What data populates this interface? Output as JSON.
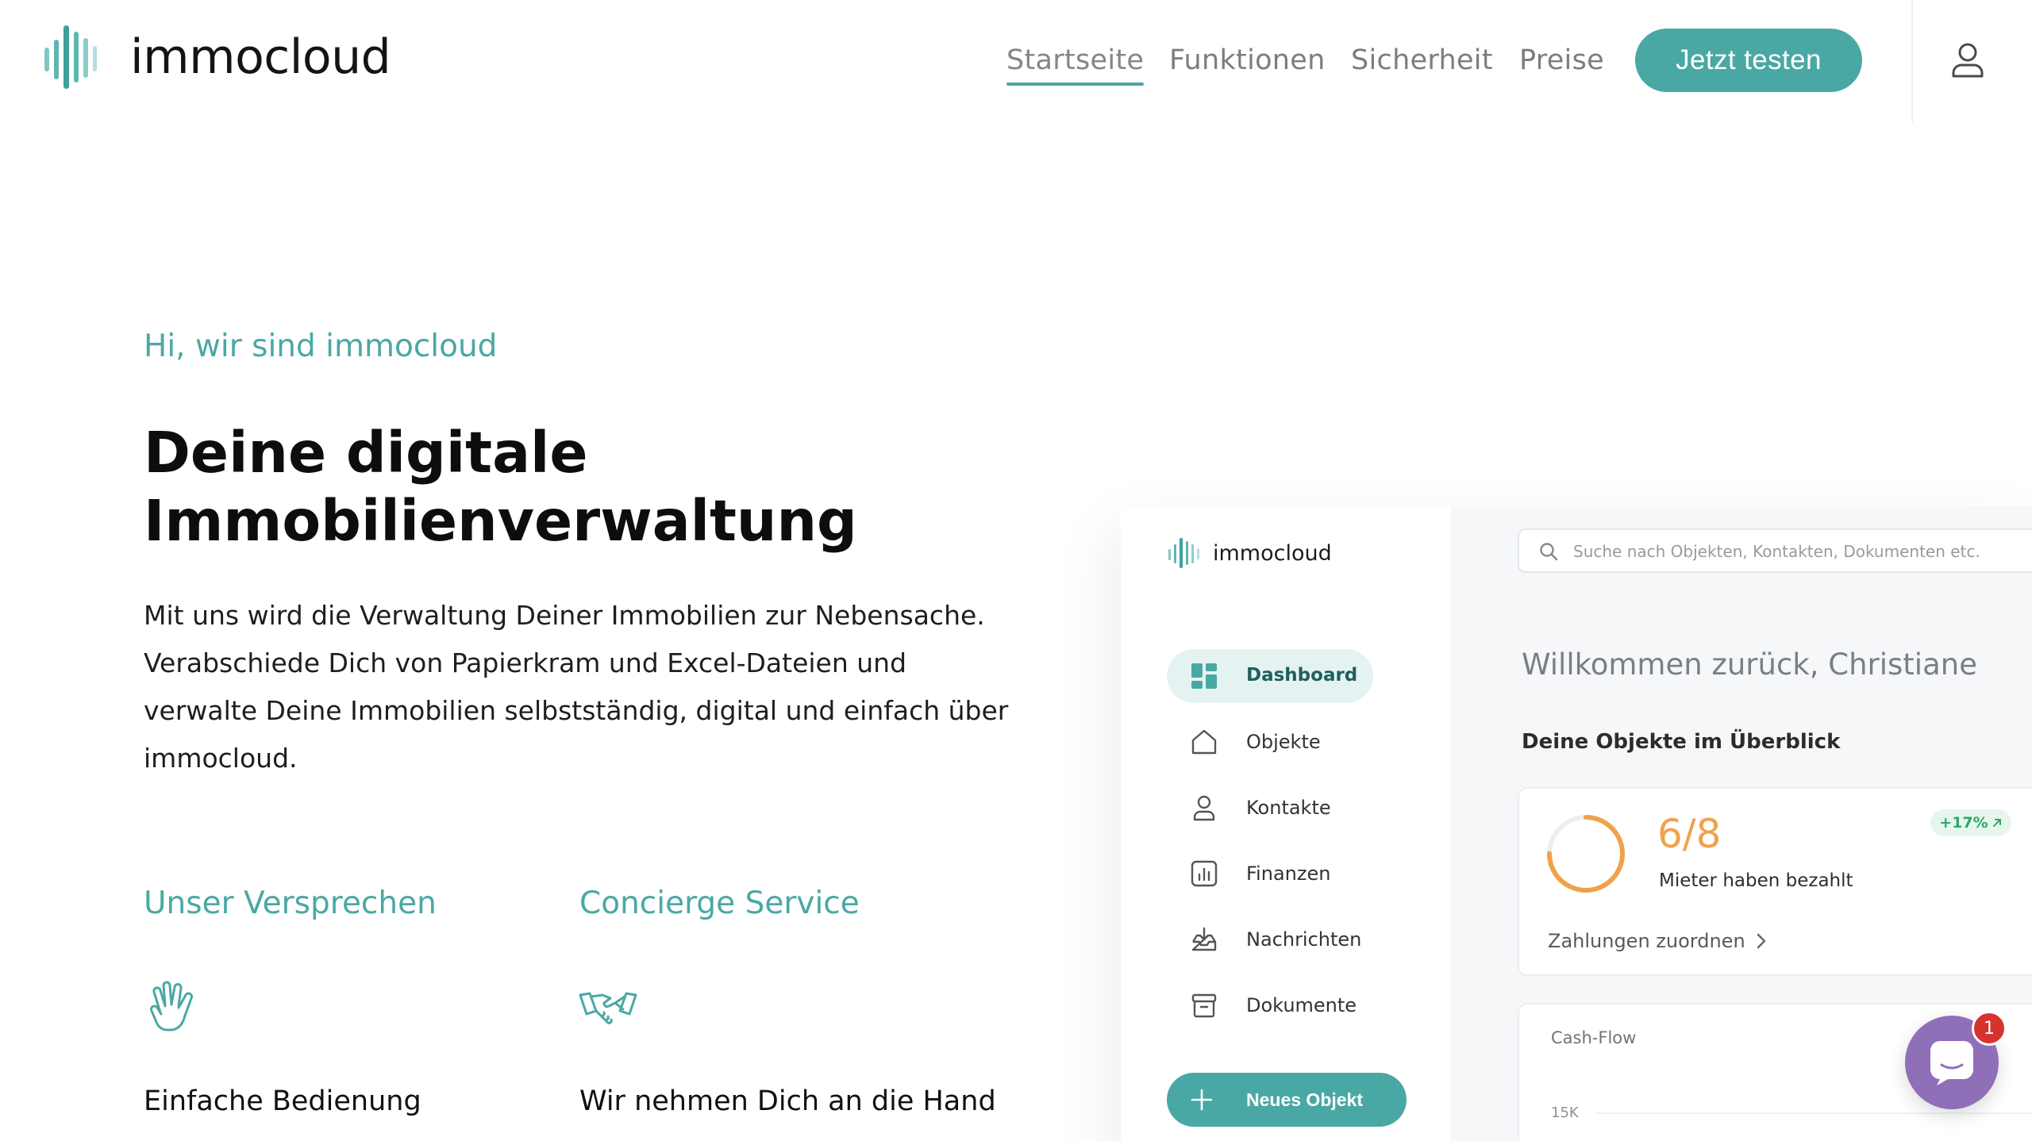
{
  "brand": {
    "name": "immocloud",
    "accent": "#4aa8a4"
  },
  "nav": {
    "items": [
      {
        "label": "Startseite",
        "active": true
      },
      {
        "label": "Funktionen",
        "active": false
      },
      {
        "label": "Sicherheit",
        "active": false
      },
      {
        "label": "Preise",
        "active": false
      }
    ],
    "cta": "Jetzt testen",
    "user_icon": "user-icon"
  },
  "hero": {
    "eyebrow": "Hi, wir sind immocloud",
    "headline": "Deine digitale Immobilienverwaltung",
    "lead": "Mit uns wird die Verwaltung Deiner Immobilien zur Nebensache. Verabschiede Dich von Papierkram und Excel-Dateien und verwalte Deine Immobilien selbstständig, digital und einfach über immocloud."
  },
  "features": [
    {
      "title": "Unser Versprechen",
      "icon": "hand-icon",
      "subtitle": "Einfache Bedienung"
    },
    {
      "title": "Concierge Service",
      "icon": "handshake-icon",
      "subtitle": "Wir nehmen Dich an die Hand"
    }
  ],
  "mockup": {
    "logo_text": "immocloud",
    "nav": [
      {
        "label": "Dashboard",
        "icon": "dashboard-icon",
        "active": true
      },
      {
        "label": "Objekte",
        "icon": "house-icon",
        "active": false
      },
      {
        "label": "Kontakte",
        "icon": "contact-icon",
        "active": false
      },
      {
        "label": "Finanzen",
        "icon": "finance-icon",
        "active": false
      },
      {
        "label": "Nachrichten",
        "icon": "inbox-icon",
        "active": false
      },
      {
        "label": "Dokumente",
        "icon": "archive-icon",
        "active": false
      }
    ],
    "new_button": "Neues Objekt",
    "search_placeholder": "Suche nach Objekten, Kontakten, Dokumenten etc.",
    "welcome": "Willkommen zurück, Christiane",
    "section_title": "Deine Objekte im Überblick",
    "payment_card": {
      "ratio": "6/8",
      "ratio_progress": 0.75,
      "subtitle": "Mieter haben bezahlt",
      "badge": "+17%",
      "link": "Zahlungen zuordnen"
    },
    "cashflow": {
      "title": "Cash-Flow",
      "tick": "15K"
    }
  },
  "chat": {
    "badge_count": "1",
    "icon": "chat-icon",
    "color": "#8f6fb8"
  }
}
